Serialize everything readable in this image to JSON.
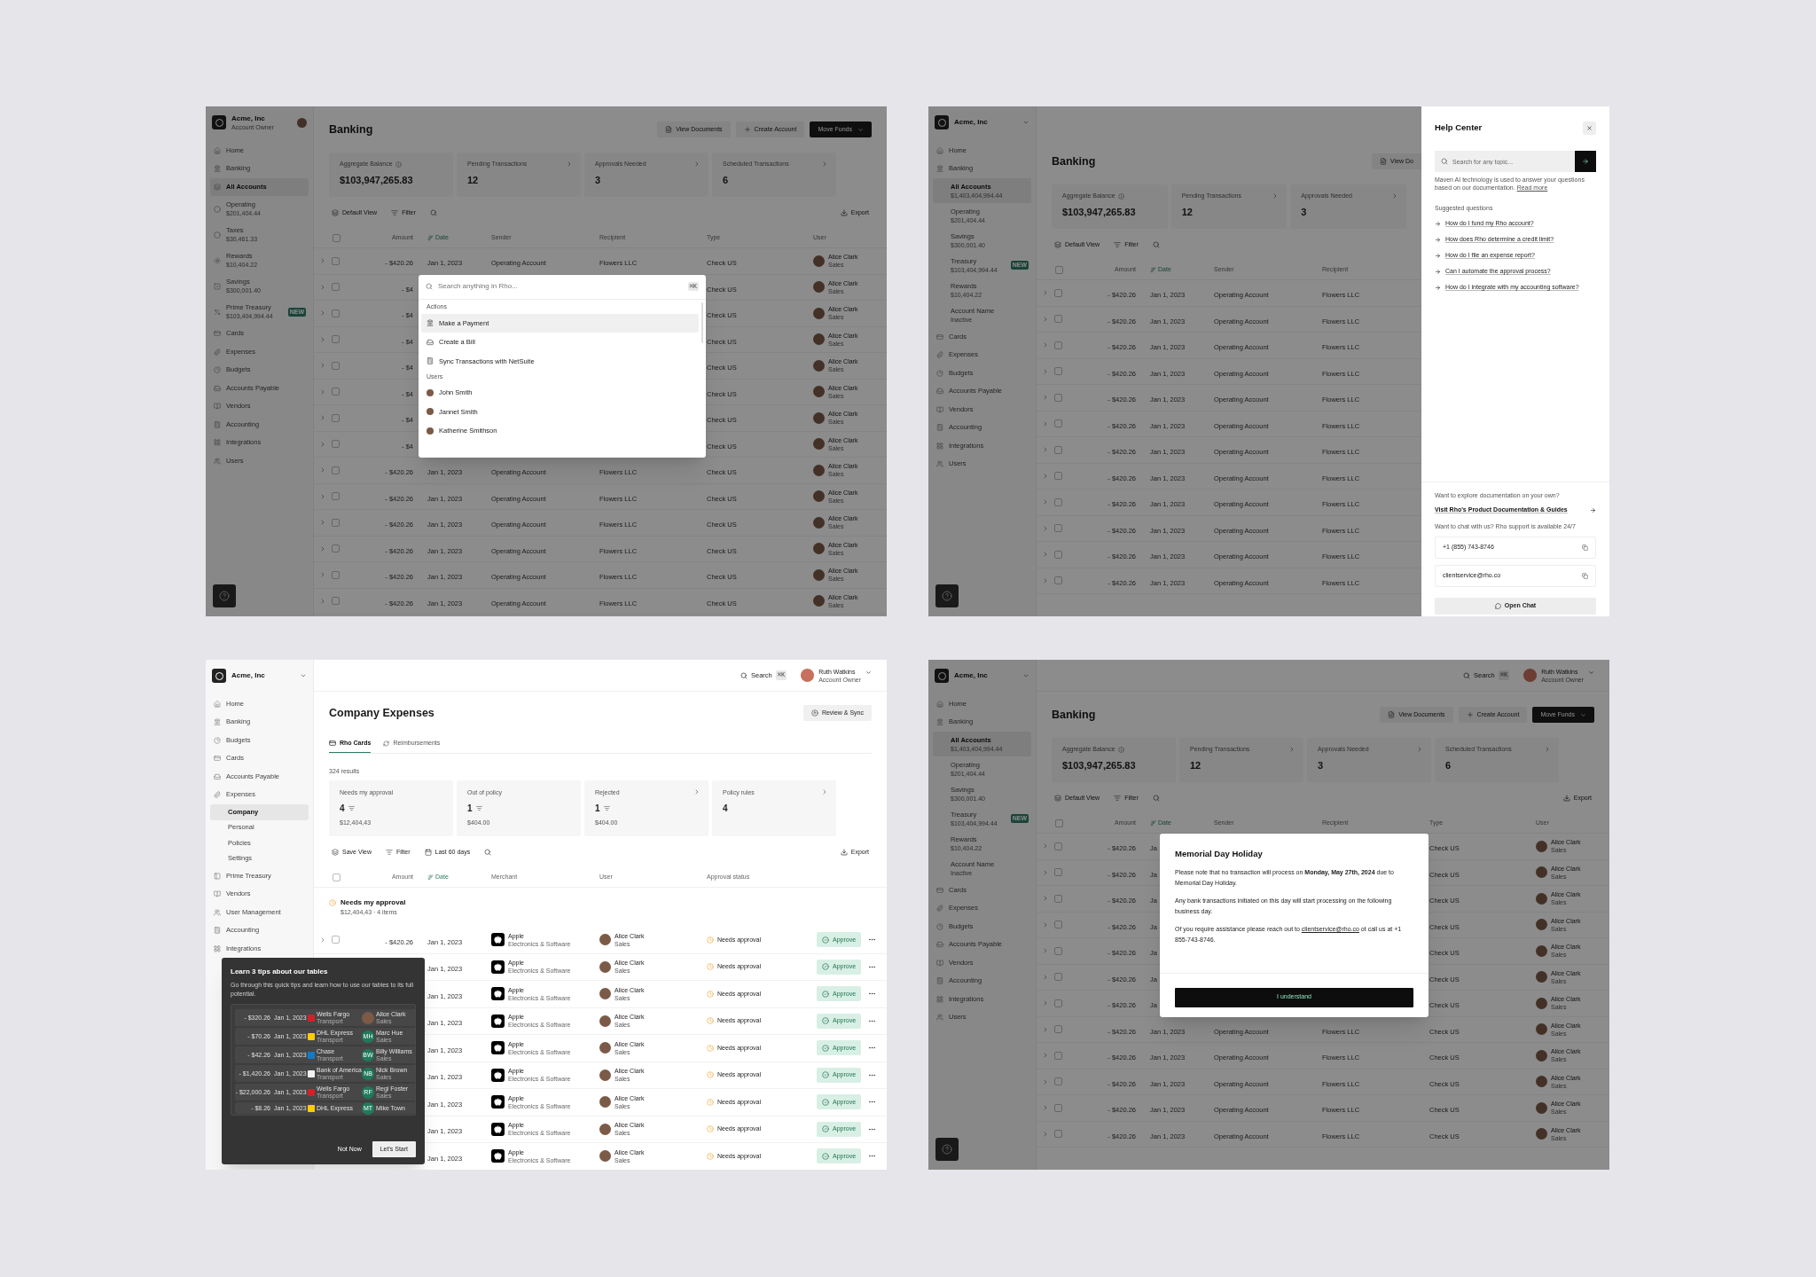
{
  "banking_search": {
    "sidebar": {
      "org": {
        "name": "Acme, Inc",
        "role": "Account Owner"
      },
      "items": [
        {
          "label": "Home",
          "selected": false
        },
        {
          "label": "Banking",
          "selected": false
        },
        {
          "label": "All Accounts",
          "selected": true
        },
        {
          "label": "Operating",
          "detail": "$201,404.44",
          "selected": false
        },
        {
          "label": "Taxes",
          "detail": "$30,461.33",
          "selected": false
        },
        {
          "label": "Rewards",
          "detail": "$10,404.22",
          "selected": false
        },
        {
          "label": "Savings",
          "detail": "$300,001.40",
          "selected": false
        },
        {
          "label": "Prime Treasury",
          "detail": "$103,404,994.44",
          "badge": "NEW",
          "selected": false
        },
        {
          "label": "Cards",
          "selected": false
        },
        {
          "label": "Expenses",
          "selected": false
        },
        {
          "label": "Budgets",
          "selected": false
        },
        {
          "label": "Accounts Payable",
          "selected": false
        },
        {
          "label": "Vendors",
          "selected": false
        },
        {
          "label": "Accounting",
          "selected": false
        },
        {
          "label": "Integrations",
          "selected": false
        },
        {
          "label": "Users",
          "selected": false
        }
      ]
    },
    "header": {
      "title": "Banking",
      "buttons": [
        {
          "label": "View Documents",
          "kind": "secondary"
        },
        {
          "label": "Create Account",
          "kind": "secondary"
        },
        {
          "label": "Move Funds",
          "kind": "primary"
        }
      ]
    },
    "stats": [
      {
        "label": "Aggregate Balance",
        "value": "$103,947,265.83",
        "info": true,
        "link": false
      },
      {
        "label": "Pending Transactions",
        "value": "12",
        "info": false,
        "link": true
      },
      {
        "label": "Approvals Needed",
        "value": "3",
        "info": false,
        "link": true
      },
      {
        "label": "Scheduled Transactions",
        "value": "6",
        "info": false,
        "link": true
      }
    ],
    "toolbar": {
      "views": [
        "Default View",
        "Filter"
      ],
      "export": "Export"
    },
    "table": {
      "checked": false,
      "columns": [
        {
          "label": "Amount",
          "sorted": false
        },
        {
          "label": "Date",
          "sorted": true
        },
        {
          "label": "Sender",
          "sorted": false
        },
        {
          "label": "Recipient",
          "sorted": false
        },
        {
          "label": "Type",
          "sorted": false
        },
        {
          "label": "User",
          "sorted": false
        }
      ],
      "rows": [
        {
          "checked": false,
          "amount": "- $420.26",
          "date": "Jan 1, 2023",
          "sender": "Operating Account",
          "recipient": "Flowers LLC",
          "type": "Check US",
          "user": {
            "name": "Alice Clark",
            "team": "Sales"
          }
        },
        {
          "checked": false,
          "amount": "- $4",
          "type": "Check US",
          "user": {
            "name": "Alice Clark",
            "team": "Sales"
          }
        },
        {
          "checked": false,
          "amount": "- $4",
          "type": "Check US",
          "user": {
            "name": "Alice Clark",
            "team": "Sales"
          }
        },
        {
          "checked": false,
          "amount": "- $4",
          "type": "Check US",
          "user": {
            "name": "Alice Clark",
            "team": "Sales"
          }
        },
        {
          "checked": false,
          "amount": "- $4",
          "type": "Check US",
          "user": {
            "name": "Alice Clark",
            "team": "Sales"
          }
        },
        {
          "checked": false,
          "amount": "- $4",
          "type": "Check US",
          "user": {
            "name": "Alice Clark",
            "team": "Sales"
          }
        },
        {
          "checked": false,
          "amount": "- $4",
          "type": "Check US",
          "user": {
            "name": "Alice Clark",
            "team": "Sales"
          }
        },
        {
          "checked": false,
          "amount": "- $4",
          "type": "Check US",
          "user": {
            "name": "Alice Clark",
            "team": "Sales"
          }
        },
        {
          "checked": false,
          "amount": "- $420.26",
          "date": "Jan 1, 2023",
          "sender": "Operating Account",
          "recipient": "Flowers LLC",
          "type": "Check US",
          "user": {
            "name": "Alice Clark",
            "team": "Sales"
          }
        },
        {
          "checked": false,
          "amount": "- $420.26",
          "date": "Jan 1, 2023",
          "sender": "Operating Account",
          "recipient": "Flowers LLC",
          "type": "Check US",
          "user": {
            "name": "Alice Clark",
            "team": "Sales"
          }
        },
        {
          "checked": false,
          "amount": "- $420.26",
          "date": "Jan 1, 2023",
          "sender": "Operating Account",
          "recipient": "Flowers LLC",
          "type": "Check US",
          "user": {
            "name": "Alice Clark",
            "team": "Sales"
          }
        },
        {
          "checked": false,
          "amount": "- $420.26",
          "date": "Jan 1, 2023",
          "sender": "Operating Account",
          "recipient": "Flowers LLC",
          "type": "Check US",
          "user": {
            "name": "Alice Clark",
            "team": "Sales"
          }
        },
        {
          "checked": false,
          "amount": "- $420.26",
          "date": "Jan 1, 2023",
          "sender": "Operating Account",
          "recipient": "Flowers LLC",
          "type": "Check US",
          "user": {
            "name": "Alice Clark",
            "team": "Sales"
          }
        },
        {
          "checked": false,
          "amount": "- $420.26",
          "date": "Jan 1, 2023",
          "sender": "Operating Account",
          "recipient": "Flowers LLC",
          "type": "Check US",
          "user": {
            "name": "Alice Clark",
            "team": "Sales"
          }
        }
      ]
    },
    "command_palette": {
      "placeholder": "Search anything in Rho...",
      "shortcut": "⌘K",
      "sections": [
        {
          "title": "Actions",
          "kind": "action",
          "items": [
            {
              "label": "Make a Payment",
              "selected": true
            },
            {
              "label": "Create a Bill",
              "selected": false
            },
            {
              "label": "Sync Transactions with NetSuite",
              "selected": false
            }
          ]
        },
        {
          "title": "Users",
          "kind": "user",
          "items": [
            {
              "label": "John Smith",
              "selected": false
            },
            {
              "label": "Jannet Smith",
              "selected": false
            },
            {
              "label": "Katherine Smithson",
              "selected": false
            }
          ]
        }
      ]
    }
  },
  "banking_help": {
    "sidebar": {
      "org": {
        "name": "Acme, Inc"
      },
      "items": [
        {
          "label": "Home",
          "selected": false
        },
        {
          "label": "Banking",
          "selected": false,
          "children": [
            {
              "label": "All Accounts",
              "detail": "$1,403,404,994.44",
              "selected": true
            },
            {
              "label": "Operating",
              "detail": "$201,404.44",
              "selected": false
            },
            {
              "label": "Savings",
              "detail": "$300,001.40",
              "selected": false
            },
            {
              "label": "Treasury",
              "detail": "$103,404,994.44",
              "badge": "NEW",
              "selected": false
            },
            {
              "label": "Rewards",
              "detail": "$10,404.22",
              "selected": false
            },
            {
              "label": "Account Name",
              "detail": "Inactive",
              "selected": false
            }
          ]
        },
        {
          "label": "Cards",
          "selected": false
        },
        {
          "label": "Expenses",
          "selected": false
        },
        {
          "label": "Budgets",
          "selected": false
        },
        {
          "label": "Accounts Payable",
          "selected": false
        },
        {
          "label": "Vendors",
          "selected": false
        },
        {
          "label": "Accounting",
          "selected": false
        },
        {
          "label": "Integrations",
          "selected": false
        },
        {
          "label": "Users",
          "selected": false
        }
      ]
    },
    "header": {
      "title": "Banking",
      "buttons": [
        {
          "label": "View Do",
          "kind": "secondary"
        }
      ]
    },
    "stats": [
      {
        "label": "Aggregate Balance",
        "value": "$103,947,265.83",
        "info": true,
        "link": false
      },
      {
        "label": "Pending Transactions",
        "value": "12",
        "info": false,
        "link": true
      },
      {
        "label": "Approvals Needed",
        "value": "3",
        "info": false,
        "link": true
      }
    ],
    "toolbar": {
      "views": [
        "Default View",
        "Filter"
      ]
    },
    "table": {
      "checked": false,
      "columns": [
        {
          "label": "Amount",
          "sorted": false
        },
        {
          "label": "Date",
          "sorted": true
        },
        {
          "label": "Sender",
          "sorted": false
        },
        {
          "label": "Recipient",
          "sorted": false
        }
      ],
      "rows": [
        {
          "checked": false,
          "amount": "- $420.26",
          "date": "Jan 1, 2023",
          "sender": "Operating Account",
          "recipient": "Flowers LLC"
        },
        {
          "checked": false,
          "amount": "- $420.26",
          "date": "Jan 1, 2023",
          "sender": "Operating Account",
          "recipient": "Flowers LLC"
        },
        {
          "checked": false,
          "amount": "- $420.26",
          "date": "Jan 1, 2023",
          "sender": "Operating Account",
          "recipient": "Flowers LLC"
        },
        {
          "checked": false,
          "amount": "- $420.26",
          "date": "Jan 1, 2023",
          "sender": "Operating Account",
          "recipient": "Flowers LLC"
        },
        {
          "checked": false,
          "amount": "- $420.26",
          "date": "Jan 1, 2023",
          "sender": "Operating Account",
          "recipient": "Flowers LLC"
        },
        {
          "checked": false,
          "amount": "- $420.26",
          "date": "Jan 1, 2023",
          "sender": "Operating Account",
          "recipient": "Flowers LLC"
        },
        {
          "checked": false,
          "amount": "- $420.26",
          "date": "Jan 1, 2023",
          "sender": "Operating Account",
          "recipient": "Flowers LLC"
        },
        {
          "checked": false,
          "amount": "- $420.26",
          "date": "Jan 1, 2023",
          "sender": "Operating Account",
          "recipient": "Flowers LLC"
        },
        {
          "checked": false,
          "amount": "- $420.26",
          "date": "Jan 1, 2023",
          "sender": "Operating Account",
          "recipient": "Flowers LLC"
        },
        {
          "checked": false,
          "amount": "- $420.26",
          "date": "Jan 1, 2023",
          "sender": "Operating Account",
          "recipient": "Flowers LLC"
        },
        {
          "checked": false,
          "amount": "- $420.26",
          "date": "Jan 1, 2023",
          "sender": "Operating Account",
          "recipient": "Flowers LLC"
        },
        {
          "checked": false,
          "amount": "- $420.26",
          "date": "Jan 1, 2023",
          "sender": "Operating Account",
          "recipient": "Flowers LLC"
        }
      ]
    },
    "help_center": {
      "title": "Help Center",
      "search_placeholder": "Search for any topic...",
      "note": "Maven AI technology is used to answer your questions based on our documentation.",
      "note_link": "Read more",
      "suggested_title": "Suggested questions",
      "questions": [
        "How do I fund my Rho account?",
        "How does Rho determine a credit limit?",
        "How do I file an expense report?",
        "Can I automate the approval process?",
        "How do I integrate with my accounting software?"
      ],
      "docs_prompt": "Want to explore documentation on your own?",
      "docs_link": "Visit Rho's Product Documentation & Guides",
      "chat_prompt": "Want to chat with us? Rho support is available 24/7",
      "contacts": [
        "+1 (855) 743-8746",
        "clientservice@rho.co"
      ],
      "chat_button": "Open Chat"
    }
  },
  "company_expenses": {
    "sidebar": {
      "org": {
        "name": "Acme, Inc"
      },
      "items": [
        {
          "label": "Home",
          "selected": false
        },
        {
          "label": "Banking",
          "selected": false
        },
        {
          "label": "Budgets",
          "selected": false
        },
        {
          "label": "Cards",
          "selected": false
        },
        {
          "label": "Accounts Payable",
          "selected": false
        },
        {
          "label": "Expenses",
          "selected": false,
          "children": [
            {
              "label": "Company",
              "selected": true
            },
            {
              "label": "Personal",
              "selected": false
            },
            {
              "label": "Policies",
              "selected": false
            },
            {
              "label": "Settings",
              "selected": false
            }
          ]
        },
        {
          "label": "Prime Treasury",
          "selected": false
        },
        {
          "label": "Vendors",
          "selected": false
        },
        {
          "label": "User Management",
          "selected": false
        },
        {
          "label": "Accounting",
          "selected": false
        },
        {
          "label": "Integrations",
          "selected": false
        }
      ]
    },
    "topbar": {
      "search": "Search",
      "shortcut": "⌘K",
      "user": {
        "name": "Ruth Watkins",
        "role": "Account Owner"
      }
    },
    "header": {
      "title": "Company Expenses",
      "buttons": [
        {
          "label": "Review & Sync",
          "kind": "secondary"
        }
      ]
    },
    "tabs": [
      {
        "label": "Rho Cards",
        "selected": true
      },
      {
        "label": "Reimbursements",
        "selected": false
      }
    ],
    "results": "324 results",
    "cards": [
      {
        "label": "Needs my approval",
        "value": "4",
        "sub": "$12,404,43",
        "filterable": true,
        "link": false
      },
      {
        "label": "Out of policy",
        "value": "1",
        "sub": "$404.00",
        "filterable": true,
        "link": false
      },
      {
        "label": "Rejected",
        "value": "1",
        "sub": "$404.00",
        "filterable": true,
        "link": true
      },
      {
        "label": "Policy rules",
        "value": "4",
        "filterable": false,
        "link": true
      }
    ],
    "toolbar": {
      "views": [
        "Save View",
        "Filter",
        "Last 60 days"
      ],
      "export": "Export"
    },
    "table": {
      "checked": false,
      "columns": [
        {
          "label": "Amount",
          "sorted": false
        },
        {
          "label": "Date",
          "sorted": true
        },
        {
          "label": "Merchant",
          "sorted": false
        },
        {
          "label": "User",
          "sorted": false
        },
        {
          "label": "Approval status",
          "sorted": false
        }
      ],
      "group": {
        "title": "Needs my approval",
        "summary": "$12,404,43 · 4 items"
      },
      "rows": [
        {
          "checked": false,
          "amount": "- $420.26",
          "date": "Jan 1, 2023",
          "merchant": {
            "name": "Apple",
            "category": "Electronics & Software"
          },
          "user": {
            "name": "Alice Clark",
            "team": "Sales"
          },
          "status": "Needs approval",
          "action": "Approve"
        },
        {
          "date": "Jan 1, 2023",
          "merchant": {
            "name": "Apple",
            "category": "Electronics & Software"
          },
          "user": {
            "name": "Alice Clark",
            "team": "Sales"
          },
          "status": "Needs approval",
          "action": "Approve"
        },
        {
          "date": "Jan 1, 2023",
          "merchant": {
            "name": "Apple",
            "category": "Electronics & Software"
          },
          "user": {
            "name": "Alice Clark",
            "team": "Sales"
          },
          "status": "Needs approval",
          "action": "Approve"
        },
        {
          "date": "Jan 1, 2023",
          "merchant": {
            "name": "Apple",
            "category": "Electronics & Software"
          },
          "user": {
            "name": "Alice Clark",
            "team": "Sales"
          },
          "status": "Needs approval",
          "action": "Approve"
        },
        {
          "date": "Jan 1, 2023",
          "merchant": {
            "name": "Apple",
            "category": "Electronics & Software"
          },
          "user": {
            "name": "Alice Clark",
            "team": "Sales"
          },
          "status": "Needs approval",
          "action": "Approve"
        },
        {
          "date": "Jan 1, 2023",
          "merchant": {
            "name": "Apple",
            "category": "Electronics & Software"
          },
          "user": {
            "name": "Alice Clark",
            "team": "Sales"
          },
          "status": "Needs approval",
          "action": "Approve"
        },
        {
          "date": "Jan 1, 2023",
          "merchant": {
            "name": "Apple",
            "category": "Electronics & Software"
          },
          "user": {
            "name": "Alice Clark",
            "team": "Sales"
          },
          "status": "Needs approval",
          "action": "Approve"
        },
        {
          "date": "Jan 1, 2023",
          "merchant": {
            "name": "Apple",
            "category": "Electronics & Software"
          },
          "user": {
            "name": "Alice Clark",
            "team": "Sales"
          },
          "status": "Needs approval",
          "action": "Approve"
        },
        {
          "date": "Jan 1, 2023",
          "merchant": {
            "name": "Apple",
            "category": "Electronics & Software"
          },
          "user": {
            "name": "Alice Clark",
            "team": "Sales"
          },
          "status": "Needs approval",
          "action": "Approve"
        }
      ]
    },
    "tips_popover": {
      "title": "Learn 3 tips about our tables",
      "text": "Go through this quick tips and learn how to use our tables to its full potential.",
      "preview_rows": [
        {
          "amount": "- $320.26",
          "date": "Jan 1, 2023",
          "merchant": "Wells Fargo",
          "category": "Transport",
          "user": "Alice Clark",
          "team": "Sales"
        },
        {
          "amount": "- $70.26",
          "date": "Jan 1, 2023",
          "merchant": "DHL Express",
          "category": "Transport",
          "initials": "MH",
          "user": "Marc Hue",
          "team": "Sales"
        },
        {
          "amount": "- $42.26",
          "date": "Jan 1, 2023",
          "merchant": "Chase",
          "category": "Transport",
          "initials": "BW",
          "user": "Billy Williams",
          "team": "Sales"
        },
        {
          "amount": "- $1,420.26",
          "date": "Jan 1, 2023",
          "merchant": "Bank of America",
          "category": "Transport",
          "initials": "NB",
          "user": "Nick Brown",
          "team": "Sales"
        },
        {
          "amount": "- $22,000.26",
          "date": "Jan 1, 2023",
          "merchant": "Wells Fargo",
          "category": "Transport",
          "initials": "RF",
          "user": "Regi Foster",
          "team": "Sales"
        },
        {
          "amount": "- $8.26",
          "date": "Jan 1, 2023",
          "merchant": "DHL Express",
          "initials": "MT",
          "user": "Mike Town"
        }
      ],
      "dismiss": "Not Now",
      "start": "Let's Start"
    }
  },
  "banking_notice": {
    "sidebar": {
      "org": {
        "name": "Acme, Inc"
      },
      "items": [
        {
          "label": "Home",
          "selected": false
        },
        {
          "label": "Banking",
          "selected": false,
          "children": [
            {
              "label": "All Accounts",
              "detail": "$1,403,404,994.44",
              "selected": true
            },
            {
              "label": "Operating",
              "detail": "$201,404.44",
              "selected": false
            },
            {
              "label": "Savings",
              "detail": "$300,001.40",
              "selected": false
            },
            {
              "label": "Treasury",
              "detail": "$103,404,994.44",
              "badge": "NEW",
              "selected": false
            },
            {
              "label": "Rewards",
              "detail": "$10,404.22",
              "selected": false
            },
            {
              "label": "Account Name",
              "detail": "Inactive",
              "selected": false
            }
          ]
        },
        {
          "label": "Cards",
          "selected": false
        },
        {
          "label": "Expenses",
          "selected": false
        },
        {
          "label": "Budgets",
          "selected": false
        },
        {
          "label": "Accounts Payable",
          "selected": false
        },
        {
          "label": "Vendors",
          "selected": false
        },
        {
          "label": "Accounting",
          "selected": false
        },
        {
          "label": "Integrations",
          "selected": false
        },
        {
          "label": "Users",
          "selected": false
        }
      ]
    },
    "topbar": {
      "search": "Search",
      "shortcut": "⌘K",
      "user": {
        "name": "Ruth Watkins",
        "role": "Account Owner"
      }
    },
    "header": {
      "title": "Banking",
      "buttons": [
        {
          "label": "View Documents",
          "kind": "secondary"
        },
        {
          "label": "Create Account",
          "kind": "secondary"
        },
        {
          "label": "Move Funds",
          "kind": "primary"
        }
      ]
    },
    "stats": [
      {
        "label": "Aggregate Balance",
        "value": "$103,947,265.83",
        "info": true,
        "link": false
      },
      {
        "label": "Pending Transactions",
        "value": "12",
        "info": false,
        "link": true
      },
      {
        "label": "Approvals Needed",
        "value": "3",
        "info": false,
        "link": true
      },
      {
        "label": "Scheduled Transactions",
        "value": "6",
        "info": false,
        "link": true
      }
    ],
    "toolbar": {
      "views": [
        "Default View",
        "Filter"
      ],
      "export": "Export"
    },
    "table": {
      "checked": false,
      "columns": [
        {
          "label": "Amount",
          "sorted": false
        },
        {
          "label": "Date",
          "sorted": true
        },
        {
          "label": "Sender",
          "sorted": false
        },
        {
          "label": "Recipient",
          "sorted": false
        },
        {
          "label": "Type",
          "sorted": false
        },
        {
          "label": "User",
          "sorted": false
        }
      ],
      "rows": [
        {
          "checked": false,
          "amount": "- $420.26",
          "date": "Ja",
          "type": "Check US",
          "user": {
            "name": "Alice Clark",
            "team": "Sales"
          }
        },
        {
          "checked": false,
          "amount": "- $420.26",
          "date": "Ja",
          "type": "Check US",
          "user": {
            "name": "Alice Clark",
            "team": "Sales"
          }
        },
        {
          "checked": false,
          "amount": "- $420.26",
          "date": "Ja",
          "type": "Check US",
          "user": {
            "name": "Alice Clark",
            "team": "Sales"
          }
        },
        {
          "checked": false,
          "amount": "- $420.26",
          "date": "Ja",
          "type": "Check US",
          "user": {
            "name": "Alice Clark",
            "team": "Sales"
          }
        },
        {
          "checked": false,
          "amount": "- $420.26",
          "date": "Ja",
          "type": "Check US",
          "user": {
            "name": "Alice Clark",
            "team": "Sales"
          }
        },
        {
          "checked": false,
          "amount": "- $420.26",
          "date": "Ja",
          "type": "Check US",
          "user": {
            "name": "Alice Clark",
            "team": "Sales"
          }
        },
        {
          "checked": false,
          "amount": "- $420.26",
          "date": "Ja",
          "type": "Check US",
          "user": {
            "name": "Alice Clark",
            "team": "Sales"
          }
        },
        {
          "checked": false,
          "amount": "- $420.26",
          "date": "Jan 1, 2023",
          "sender": "Operating Account",
          "recipient": "Flowers LLC",
          "type": "Check US",
          "user": {
            "name": "Alice Clark",
            "team": "Sales"
          }
        },
        {
          "checked": false,
          "amount": "- $420.26",
          "date": "Jan 1, 2023",
          "sender": "Operating Account",
          "recipient": "Flowers LLC",
          "type": "Check US",
          "user": {
            "name": "Alice Clark",
            "team": "Sales"
          }
        },
        {
          "checked": false,
          "amount": "- $420.26",
          "date": "Jan 1, 2023",
          "sender": "Operating Account",
          "recipient": "Flowers LLC",
          "type": "Check US",
          "user": {
            "name": "Alice Clark",
            "team": "Sales"
          }
        },
        {
          "checked": false,
          "amount": "- $420.26",
          "date": "Jan 1, 2023",
          "sender": "Operating Account",
          "recipient": "Flowers LLC",
          "type": "Check US",
          "user": {
            "name": "Alice Clark",
            "team": "Sales"
          }
        },
        {
          "checked": false,
          "amount": "- $420.26",
          "date": "Jan 1, 2023",
          "sender": "Operating Account",
          "recipient": "Flowers LLC",
          "type": "Check US",
          "user": {
            "name": "Alice Clark",
            "team": "Sales"
          }
        }
      ]
    },
    "notice": {
      "title": "Memorial Day Holiday",
      "paragraphs": [
        "Please note that no transaction will process on **Monday, May 27th, 2024** due to Memorial Day Holiday.",
        "Any bank transactions initiated on this day will start processing on the following business day."
      ],
      "contact": {
        "before": "Of you require assistance please reach out to",
        "link": "clientservice@rho.co",
        "after": "ot call us at +1 855-743-8746."
      },
      "button": "I understand"
    }
  }
}
